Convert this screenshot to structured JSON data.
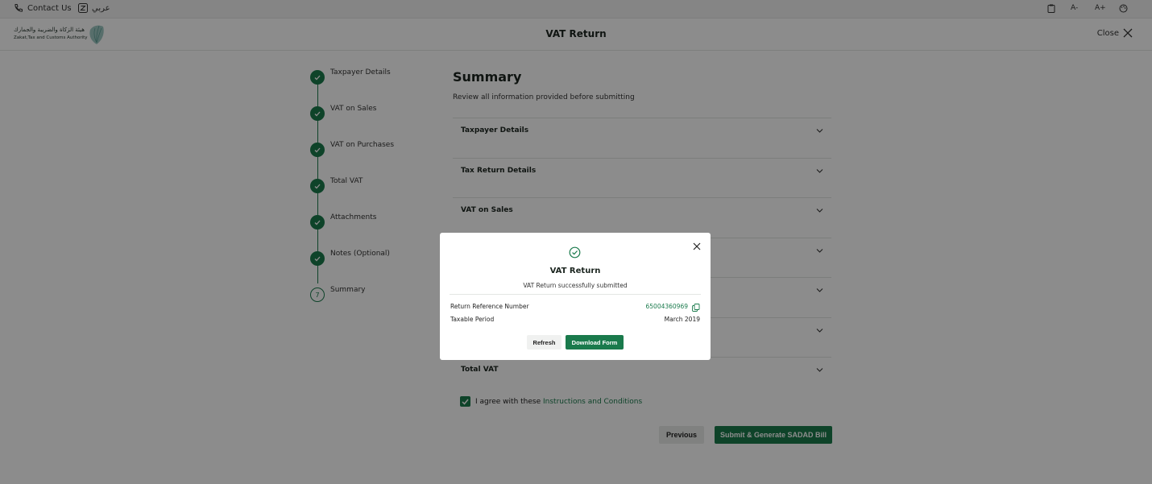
{
  "topbar": {
    "contact_label": "Contact Us",
    "language_label": "عربي",
    "font_decrease_label": "A-",
    "font_increase_label": "A+"
  },
  "header": {
    "logo_ar": "هيئة الزكاة والضريبة والجمارك",
    "logo_en": "Zakat,Tax and Customs Authority",
    "title": "VAT Return",
    "close_label": "Close"
  },
  "stepper": {
    "steps": [
      {
        "label": "Taxpayer Details",
        "status": "done"
      },
      {
        "label": "VAT on Sales",
        "status": "done"
      },
      {
        "label": "VAT on Purchases",
        "status": "done"
      },
      {
        "label": "Total VAT",
        "status": "done"
      },
      {
        "label": "Attachments",
        "status": "done"
      },
      {
        "label": "Notes (Optional)",
        "status": "done"
      },
      {
        "label": "Summary",
        "status": "current",
        "number": "7"
      }
    ]
  },
  "summary": {
    "title": "Summary",
    "subtitle": "Review all information provided before submitting",
    "sections": [
      "Taxpayer Details",
      "Tax Return Details",
      "VAT on Sales",
      "",
      "",
      "",
      "Total VAT"
    ],
    "agree_prefix": "I agree with these ",
    "agree_link": "Instructions and Conditions",
    "agree_checked": true,
    "previous_label": "Previous",
    "submit_label": "Submit & Generate SADAD Bill"
  },
  "modal": {
    "title": "VAT Return",
    "message": "VAT Return successfully submitted",
    "ref_label": "Return Reference Number",
    "ref_value": "65004360969",
    "period_label": "Taxable Period",
    "period_value": "March 2019",
    "refresh_label": "Refresh",
    "download_label": "Download Form"
  },
  "colors": {
    "brand_green": "#1a7a4c",
    "overlay": "rgba(0,0,0,0.45)"
  }
}
